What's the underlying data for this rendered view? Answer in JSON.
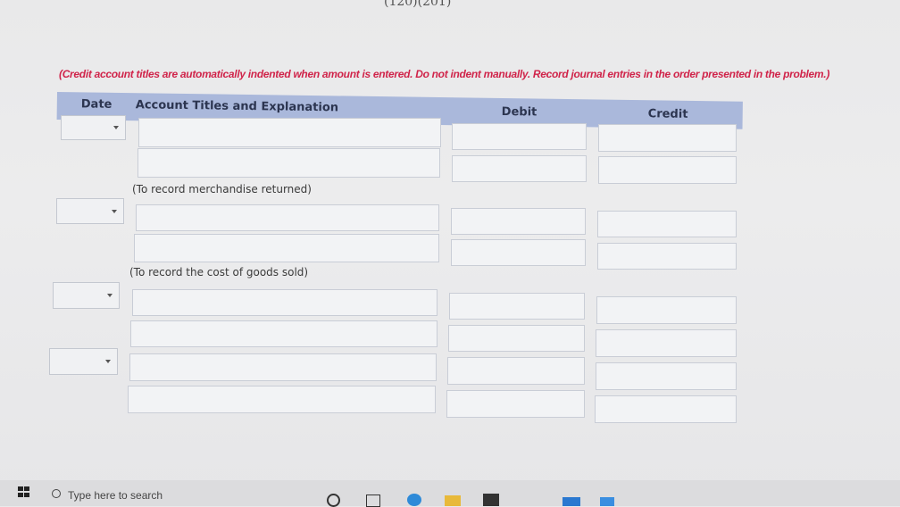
{
  "top_text": "(120)(201)",
  "instructions": "(Credit account titles are automatically indented when amount is entered. Do not indent manually. Record journal entries in the order presented in the problem.)",
  "table": {
    "headers": {
      "date": "Date",
      "account": "Account Titles and Explanation",
      "debit": "Debit",
      "credit": "Credit"
    }
  },
  "entries": [
    {
      "note": "(To record merchandise returned)"
    },
    {
      "note": "(To record the cost of goods sold)"
    }
  ],
  "taskbar": {
    "search_placeholder": "Type here to search"
  },
  "colors": {
    "header_bg": "#aab8db",
    "instruction_text": "#d0244a"
  }
}
